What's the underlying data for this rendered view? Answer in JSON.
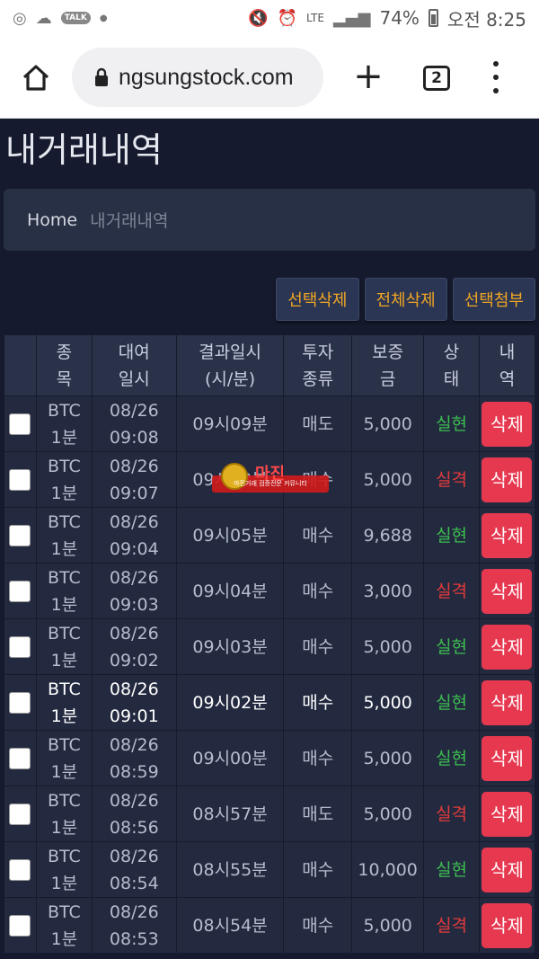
{
  "status_bar": {
    "battery": "74%",
    "time": "오전 8:25",
    "network": "LTE",
    "talk_badge": "TALK"
  },
  "browser": {
    "url": "ngsungstock.com",
    "tab_count": "2"
  },
  "page": {
    "title": "내거래내역",
    "breadcrumb_home": "Home",
    "breadcrumb_current": "내거래내역"
  },
  "actions": {
    "delete_selected": "선택삭제",
    "delete_all": "전체삭제",
    "attach_selected": "선택첨부"
  },
  "table": {
    "headers": [
      [
        "종",
        "목"
      ],
      [
        "대여",
        "일시"
      ],
      [
        "결과일시",
        "(시/분)"
      ],
      [
        "투자",
        "종류"
      ],
      [
        "보증",
        "금"
      ],
      [
        "상",
        "태"
      ],
      [
        "내",
        "역"
      ]
    ],
    "rows": [
      {
        "symbol": "BTC",
        "interval": "1분",
        "date": "08/26",
        "time": "09:08",
        "result": "09시09분",
        "type": "매도",
        "amount": "5,000",
        "status": "실현",
        "action": "삭제"
      },
      {
        "symbol": "BTC",
        "interval": "1분",
        "date": "08/26",
        "time": "09:07",
        "result": "09시08분",
        "type": "매수",
        "amount": "5,000",
        "status": "실격",
        "action": "삭제"
      },
      {
        "symbol": "BTC",
        "interval": "1분",
        "date": "08/26",
        "time": "09:04",
        "result": "09시05분",
        "type": "매수",
        "amount": "9,688",
        "status": "실현",
        "action": "삭제"
      },
      {
        "symbol": "BTC",
        "interval": "1분",
        "date": "08/26",
        "time": "09:03",
        "result": "09시04분",
        "type": "매수",
        "amount": "3,000",
        "status": "실격",
        "action": "삭제"
      },
      {
        "symbol": "BTC",
        "interval": "1분",
        "date": "08/26",
        "time": "09:02",
        "result": "09시03분",
        "type": "매수",
        "amount": "5,000",
        "status": "실현",
        "action": "삭제"
      },
      {
        "symbol": "BTC",
        "interval": "1분",
        "date": "08/26",
        "time": "09:01",
        "result": "09시02분",
        "type": "매수",
        "amount": "5,000",
        "status": "실현",
        "action": "삭제"
      },
      {
        "symbol": "BTC",
        "interval": "1분",
        "date": "08/26",
        "time": "08:59",
        "result": "09시00분",
        "type": "매수",
        "amount": "5,000",
        "status": "실현",
        "action": "삭제"
      },
      {
        "symbol": "BTC",
        "interval": "1분",
        "date": "08/26",
        "time": "08:56",
        "result": "08시57분",
        "type": "매도",
        "amount": "5,000",
        "status": "실격",
        "action": "삭제"
      },
      {
        "symbol": "BTC",
        "interval": "1분",
        "date": "08/26",
        "time": "08:54",
        "result": "08시55분",
        "type": "매수",
        "amount": "10,000",
        "status": "실현",
        "action": "삭제"
      },
      {
        "symbol": "BTC",
        "interval": "1분",
        "date": "08/26",
        "time": "08:53",
        "result": "08시54분",
        "type": "매수",
        "amount": "5,000",
        "status": "실격",
        "action": "삭제"
      }
    ]
  },
  "watermark": {
    "title": "마진",
    "subtitle": "마진거래 검증전문 커뮤니티"
  },
  "colors": {
    "background": "#151a2e",
    "accent_button_text": "#f0a623",
    "status_win": "#3dbd4f",
    "status_lose": "#e33a3a",
    "delete_button": "#e63950"
  }
}
